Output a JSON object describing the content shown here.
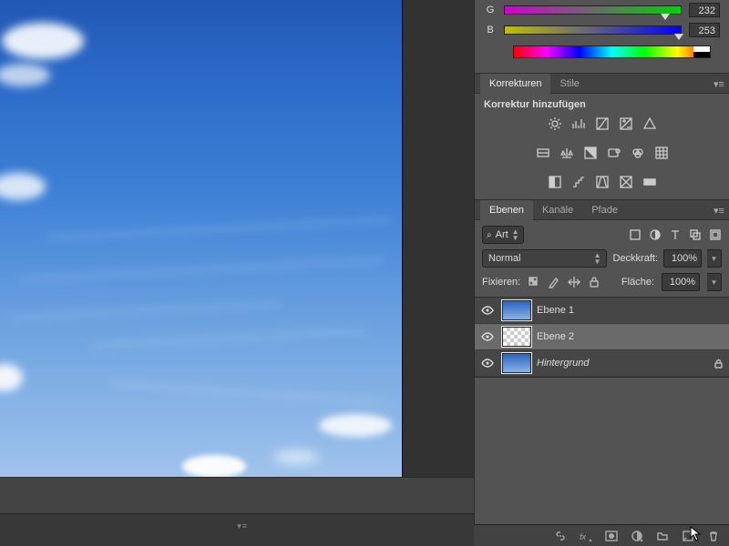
{
  "color_panel": {
    "channels": [
      {
        "letter": "G",
        "value": "232",
        "pos_pct": 91
      },
      {
        "letter": "B",
        "value": "253",
        "pos_pct": 99
      }
    ]
  },
  "adjustments": {
    "tabs": [
      {
        "label": "Korrekturen",
        "active": true
      },
      {
        "label": "Stile",
        "active": false
      }
    ],
    "heading": "Korrektur hinzufügen",
    "icons_row1": [
      "brightness-icon",
      "levels-icon",
      "curves-icon",
      "exposure-icon",
      "vibrance-icon"
    ],
    "icons_row2": [
      "hue-icon",
      "balance-icon",
      "bw-icon",
      "photo-filter-icon",
      "channel-mixer-icon",
      "lut-icon"
    ],
    "icons_row3": [
      "invert-icon",
      "posterize-icon",
      "threshold-icon",
      "selective-icon",
      "gradient-map-icon"
    ]
  },
  "layers_panel": {
    "tabs": [
      {
        "label": "Ebenen",
        "active": true
      },
      {
        "label": "Kanäle",
        "active": false
      },
      {
        "label": "Pfade",
        "active": false
      }
    ],
    "filter_label": "Art",
    "mode_icons": [
      "pixel-filter-icon",
      "adjustment-filter-icon",
      "type-filter-icon",
      "shape-filter-icon",
      "smart-filter-icon"
    ],
    "blend_mode": "Normal",
    "opacity_label": "Deckkraft:",
    "opacity_value": "100%",
    "lock_label": "Fixieren:",
    "lock_icons": [
      "lock-transparent-icon",
      "lock-pixels-icon",
      "lock-position-icon",
      "lock-all-icon"
    ],
    "fill_label": "Fläche:",
    "fill_value": "100%",
    "layers": [
      {
        "name": "Ebene 1",
        "thumb": "sky",
        "selected": false,
        "locked": false,
        "bg": false
      },
      {
        "name": "Ebene 2",
        "thumb": "trans",
        "selected": true,
        "locked": false,
        "bg": false
      },
      {
        "name": "Hintergrund",
        "thumb": "sky",
        "selected": false,
        "locked": true,
        "bg": true
      }
    ],
    "bottom_icons": [
      "link-icon",
      "fx-icon",
      "mask-icon",
      "adjustment-layer-icon",
      "group-icon",
      "new-layer-icon",
      "trash-icon"
    ]
  }
}
